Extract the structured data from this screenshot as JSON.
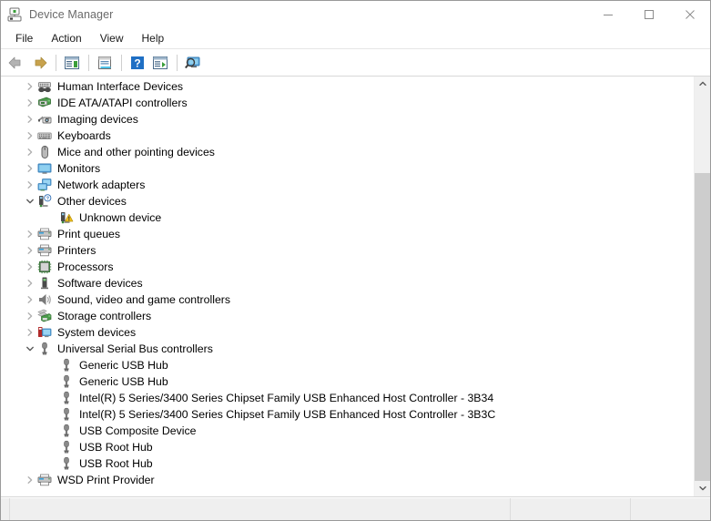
{
  "window": {
    "title": "Device Manager",
    "title_icon": "device-manager-icon"
  },
  "caption": {
    "minimize_label": "Minimize",
    "maximize_label": "Maximize",
    "close_label": "Close"
  },
  "menu": {
    "items": [
      {
        "label": "File",
        "name": "menu-file"
      },
      {
        "label": "Action",
        "name": "menu-action"
      },
      {
        "label": "View",
        "name": "menu-view"
      },
      {
        "label": "Help",
        "name": "menu-help"
      }
    ]
  },
  "toolbar": {
    "buttons": [
      {
        "name": "back-button",
        "icon": "back-arrow-icon",
        "tooltip": "Back"
      },
      {
        "name": "forward-button",
        "icon": "forward-arrow-icon",
        "tooltip": "Forward"
      },
      {
        "name": "show-hide-console-tree-button",
        "icon": "console-tree-icon",
        "tooltip": "Show/Hide Console Tree"
      },
      {
        "name": "properties-button",
        "icon": "properties-icon",
        "tooltip": "Properties"
      },
      {
        "name": "help-button",
        "icon": "help-question-icon",
        "tooltip": "Help"
      },
      {
        "name": "update-driver-button",
        "icon": "update-driver-icon",
        "tooltip": "Update Driver Software"
      },
      {
        "name": "scan-hardware-changes-button",
        "icon": "scan-hardware-icon",
        "tooltip": "Scan for hardware changes"
      }
    ]
  },
  "tree": {
    "rows": [
      {
        "label": "Human Interface Devices",
        "icon": "hid-game-controller-icon",
        "indent": 0,
        "state": "collapsed"
      },
      {
        "label": "IDE ATA/ATAPI controllers",
        "icon": "ide-controller-icon",
        "indent": 0,
        "state": "collapsed"
      },
      {
        "label": "Imaging devices",
        "icon": "camera-icon",
        "indent": 0,
        "state": "collapsed"
      },
      {
        "label": "Keyboards",
        "icon": "keyboard-icon",
        "indent": 0,
        "state": "collapsed"
      },
      {
        "label": "Mice and other pointing devices",
        "icon": "mouse-icon",
        "indent": 0,
        "state": "collapsed"
      },
      {
        "label": "Monitors",
        "icon": "monitor-icon",
        "indent": 0,
        "state": "collapsed"
      },
      {
        "label": "Network adapters",
        "icon": "network-adapter-icon",
        "indent": 0,
        "state": "collapsed"
      },
      {
        "label": "Other devices",
        "icon": "other-device-question-icon",
        "indent": 0,
        "state": "expanded"
      },
      {
        "label": "Unknown device",
        "icon": "unknown-device-warning-icon",
        "indent": 1,
        "state": "leaf"
      },
      {
        "label": "Print queues",
        "icon": "printer-icon",
        "indent": 0,
        "state": "collapsed"
      },
      {
        "label": "Printers",
        "icon": "printer-icon",
        "indent": 0,
        "state": "collapsed"
      },
      {
        "label": "Processors",
        "icon": "processor-chip-icon",
        "indent": 0,
        "state": "collapsed"
      },
      {
        "label": "Software devices",
        "icon": "software-device-icon",
        "indent": 0,
        "state": "collapsed"
      },
      {
        "label": "Sound, video and game controllers",
        "icon": "speaker-icon",
        "indent": 0,
        "state": "collapsed"
      },
      {
        "label": "Storage controllers",
        "icon": "storage-controller-icon",
        "indent": 0,
        "state": "collapsed"
      },
      {
        "label": "System devices",
        "icon": "system-device-icon",
        "indent": 0,
        "state": "collapsed"
      },
      {
        "label": "Universal Serial Bus controllers",
        "icon": "usb-icon",
        "indent": 0,
        "state": "expanded"
      },
      {
        "label": "Generic USB Hub",
        "icon": "usb-icon",
        "indent": 1,
        "state": "leaf"
      },
      {
        "label": "Generic USB Hub",
        "icon": "usb-icon",
        "indent": 1,
        "state": "leaf"
      },
      {
        "label": "Intel(R) 5 Series/3400 Series Chipset Family USB Enhanced Host Controller - 3B34",
        "icon": "usb-icon",
        "indent": 1,
        "state": "leaf"
      },
      {
        "label": "Intel(R) 5 Series/3400 Series Chipset Family USB Enhanced Host Controller - 3B3C",
        "icon": "usb-icon",
        "indent": 1,
        "state": "leaf"
      },
      {
        "label": "USB Composite Device",
        "icon": "usb-icon",
        "indent": 1,
        "state": "leaf"
      },
      {
        "label": "USB Root Hub",
        "icon": "usb-icon",
        "indent": 1,
        "state": "leaf"
      },
      {
        "label": "USB Root Hub",
        "icon": "usb-icon",
        "indent": 1,
        "state": "leaf"
      },
      {
        "label": "WSD Print Provider",
        "icon": "printer-icon",
        "indent": 0,
        "state": "collapsed"
      }
    ]
  },
  "scrollbar": {
    "up_arrow": "chevron-up-icon",
    "down_arrow": "chevron-down-icon",
    "thumb_name": "vertical-scroll-thumb"
  },
  "statusbar": {
    "panes": [
      "",
      "",
      ""
    ]
  },
  "colors": {
    "accent": "#0078d7",
    "window_border": "#9a9a9a",
    "title_text": "#6a6a6a",
    "text": "#000000",
    "status_bg": "#efefef",
    "scroll_track": "#cdcdcd",
    "scroll_thumb": "#f0f0f0"
  }
}
